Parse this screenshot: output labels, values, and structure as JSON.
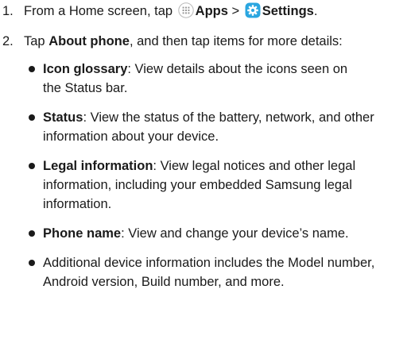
{
  "steps": [
    {
      "number": "1.",
      "text_before": "From a Home screen, tap",
      "apps_icon": "apps-grid-icon",
      "apps_label": "Apps",
      "separator": ">",
      "settings_icon": "settings-gear-icon",
      "settings_label": "Settings",
      "text_after": "."
    },
    {
      "number": "2.",
      "text_before": "Tap",
      "about_label": "About phone",
      "text_after": ", and then tap items for more details:"
    }
  ],
  "bullets": [
    {
      "term": "Icon glossary",
      "text": ": View details about the icons seen on the Status bar."
    },
    {
      "term": "Status",
      "text": ": View the status of the battery, network, and other information about your device."
    },
    {
      "term": "Legal information",
      "text": ": View legal notices and other legal information, including your embedded Samsung legal information."
    },
    {
      "term": "Phone name",
      "text": ": View and change your device’s name."
    },
    {
      "term": "",
      "text": "Additional device information includes the Model number, Android version, Build number, and more."
    }
  ],
  "colors": {
    "text": "#1a1a1a",
    "settings_icon_bg": "#2aa6e0",
    "apps_icon_dots": "#9a9a9a"
  }
}
